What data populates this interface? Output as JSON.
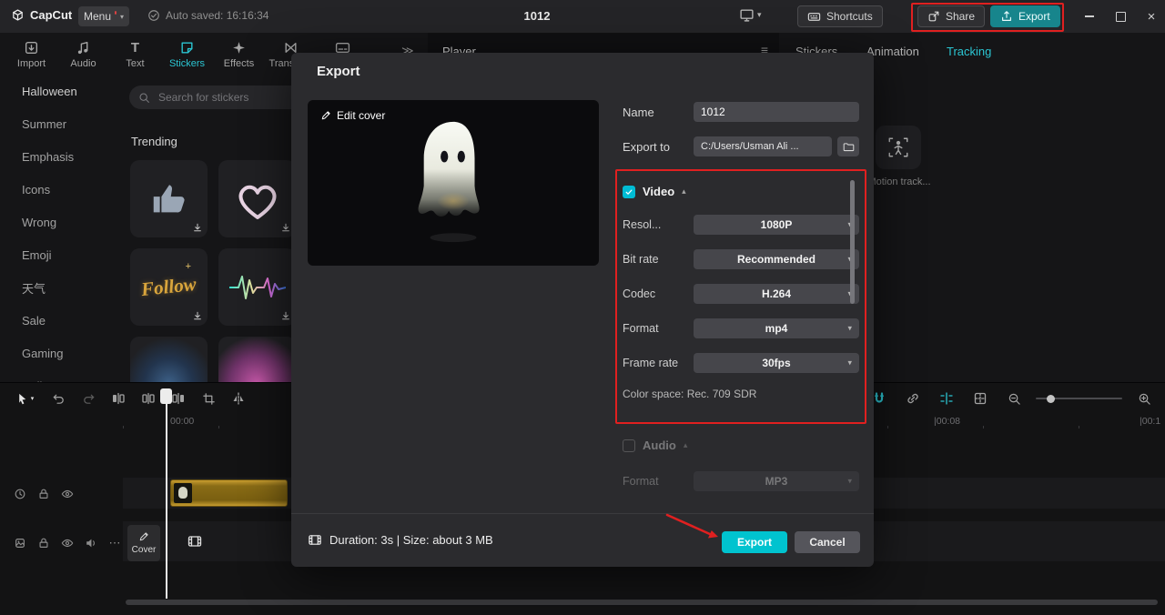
{
  "topbar": {
    "logo_text": "CapCut",
    "menu_label": "Menu",
    "autosave_text": "Auto saved: 16:16:34",
    "project_title": "1012",
    "shortcuts_label": "Shortcuts",
    "share_label": "Share",
    "export_label": "Export"
  },
  "glyphs": {
    "caret_down": "▾",
    "caret_up": "▴",
    "panel_collapse": "≫",
    "hamburger": "≡",
    "more": "⋯",
    "close": "×",
    "text_tool": "T"
  },
  "media_tabs": {
    "items": [
      {
        "label": "Import"
      },
      {
        "label": "Audio"
      },
      {
        "label": "Text"
      },
      {
        "label": "Stickers"
      },
      {
        "label": "Effects"
      },
      {
        "label": "Transition"
      },
      {
        "label": ""
      }
    ]
  },
  "sticker_categories": [
    "Halloween",
    "Summer",
    "Emphasis",
    "Icons",
    "Wrong",
    "Emoji",
    "天气",
    "Sale",
    "Gaming",
    "Collage"
  ],
  "stickers_panel": {
    "search_placeholder": "Search for stickers",
    "section_title": "Trending",
    "follow_sticker_text": "Follow"
  },
  "player_panel": {
    "title": "Player",
    "tabs": [
      "Stickers",
      "Animation",
      "Tracking"
    ],
    "motion_track_label": "Motion track..."
  },
  "export_dialog": {
    "title": "Export",
    "edit_cover_label": "Edit cover",
    "name_label": "Name",
    "name_value": "1012",
    "export_to_label": "Export to",
    "export_to_value": "C:/Users/Usman Ali ...",
    "video": {
      "label": "Video",
      "fields": [
        {
          "label": "Resol...",
          "value": "1080P"
        },
        {
          "label": "Bit rate",
          "value": "Recommended"
        },
        {
          "label": "Codec",
          "value": "H.264"
        },
        {
          "label": "Format",
          "value": "mp4"
        },
        {
          "label": "Frame rate",
          "value": "30fps"
        }
      ],
      "color_space_text": "Color space: Rec. 709 SDR"
    },
    "audio": {
      "label": "Audio",
      "format_label": "Format",
      "format_value": "MP3"
    },
    "footer_info": "Duration: 3s | Size: about 3 MB",
    "export_button_label": "Export",
    "cancel_button_label": "Cancel"
  },
  "timeline": {
    "ruler": [
      "00:00",
      "|00:08",
      "|00:1"
    ],
    "cover_button_label": "Cover"
  },
  "colors": {
    "accent": "#00c3cf",
    "annotation_red": "#e02020",
    "clip_gold": "#8a6c16"
  }
}
